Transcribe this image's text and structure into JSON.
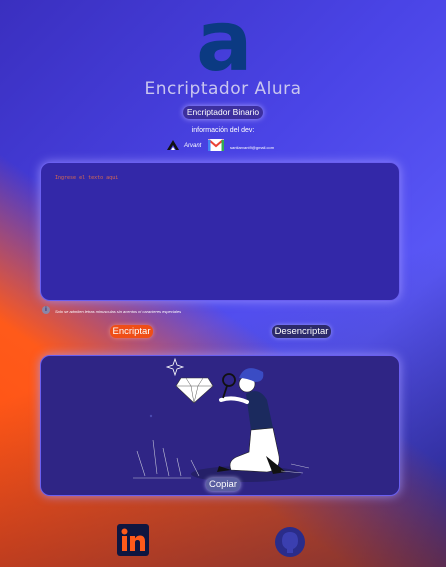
{
  "app": {
    "logo_letter": "a",
    "title": "Encriptador Alura",
    "mode_pill": "Encriptador Binario"
  },
  "developer": {
    "label": "información del dev:",
    "name": "Arvant",
    "email": "santiarvant9@gmail.com"
  },
  "input": {
    "placeholder": "Ingrese el texto aqui"
  },
  "info": {
    "icon": "i",
    "text": "Solo se admiten letras minusculas sin acentos ni caracteres especiales"
  },
  "buttons": {
    "encrypt": "Encriptar",
    "decrypt": "Desencriptar",
    "copy": "Copiar"
  },
  "footer": {
    "linkedin_icon": "linkedin-icon",
    "github_icon": "github-icon"
  },
  "colors": {
    "accent_orange": "#ef4e17",
    "logo_blue": "#0b3a82",
    "bg_purple": "#4a44e6"
  }
}
